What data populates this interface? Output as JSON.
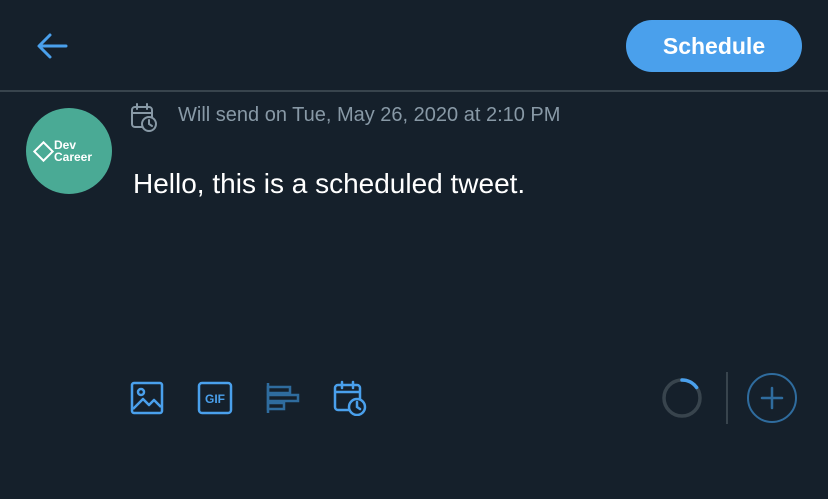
{
  "header": {
    "back_icon": "arrow-left-icon",
    "schedule_label": "Schedule"
  },
  "avatar": {
    "line1": "Dev",
    "line2": "Career"
  },
  "scheduled_info": {
    "icon": "calendar-clock-icon",
    "text": "Will send on Tue, May 26, 2020 at 2:10 PM"
  },
  "tweet": {
    "text": "Hello, this is a scheduled tweet."
  },
  "toolbar": {
    "icons": [
      "image-icon",
      "gif-icon",
      "poll-icon",
      "schedule-icon"
    ],
    "gif_label": "GIF",
    "add_icon": "plus-icon"
  },
  "character_count": {
    "progress": 0.15
  },
  "colors": {
    "background": "#15202b",
    "accent": "#4aa0ec",
    "muted_text": "#8899a6",
    "divider": "#38444d",
    "avatar_bg": "#4aaa95"
  }
}
